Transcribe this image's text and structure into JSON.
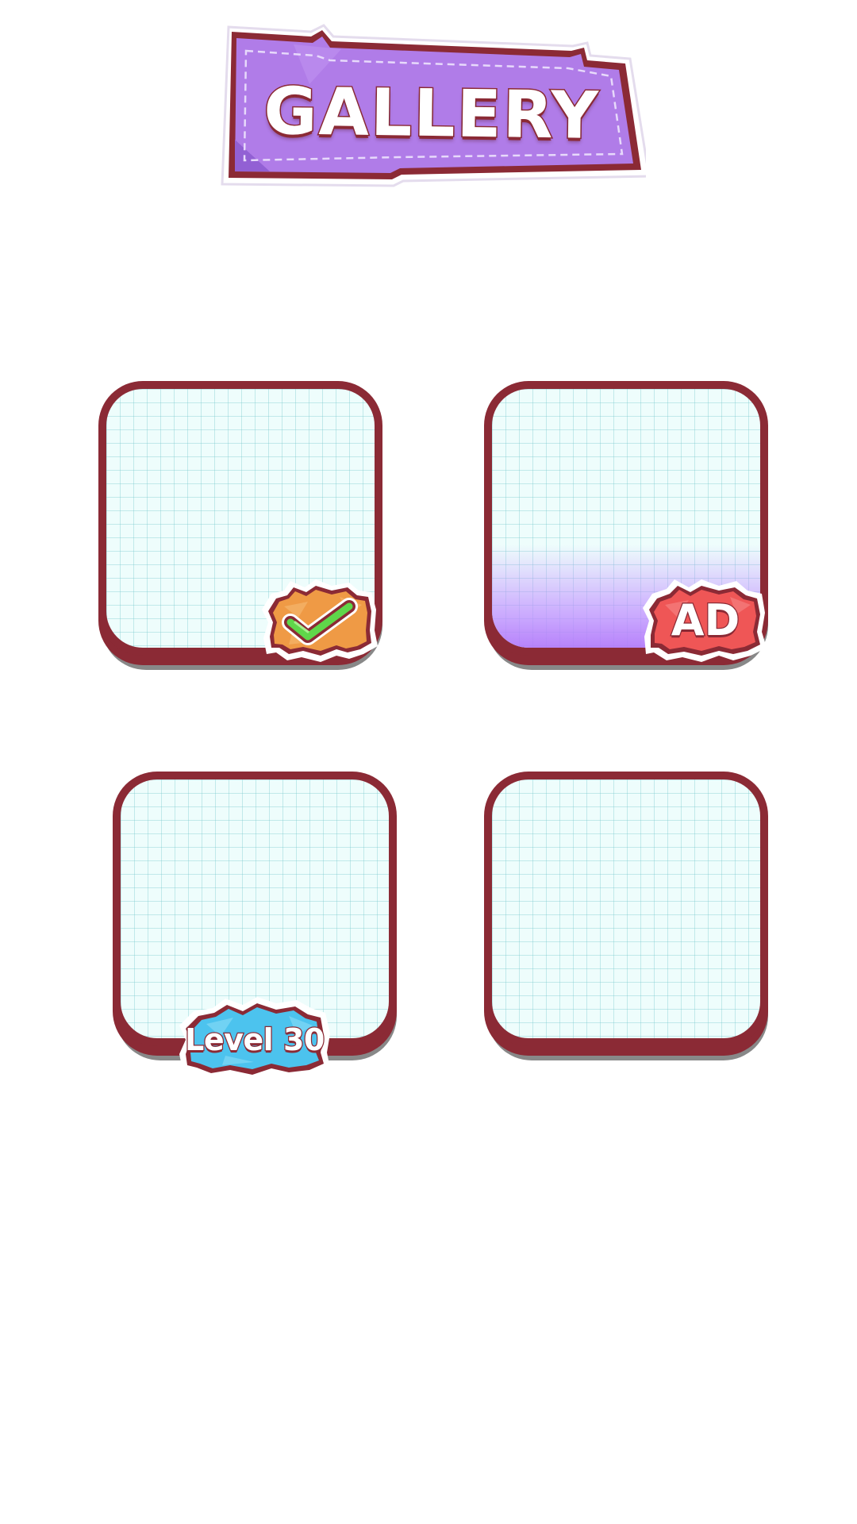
{
  "header": {
    "title": "GALLERY"
  },
  "gallery": {
    "cards": [
      {
        "status": "completed",
        "badge_icon": "checkmark-icon",
        "badge_color": "#ef9a45"
      },
      {
        "status": "ad_locked",
        "badge_label": "AD",
        "badge_color": "#ef5656"
      },
      {
        "status": "level_locked",
        "badge_label": "Level 30",
        "badge_color": "#4cc3ee"
      },
      {
        "status": "empty"
      }
    ]
  },
  "colors": {
    "banner_purple": "#b07ce8",
    "frame_maroon": "#8b2a35",
    "paper": "#eefdfc",
    "grid_line": "#a8e2e4",
    "check_green": "#5fd64a"
  }
}
